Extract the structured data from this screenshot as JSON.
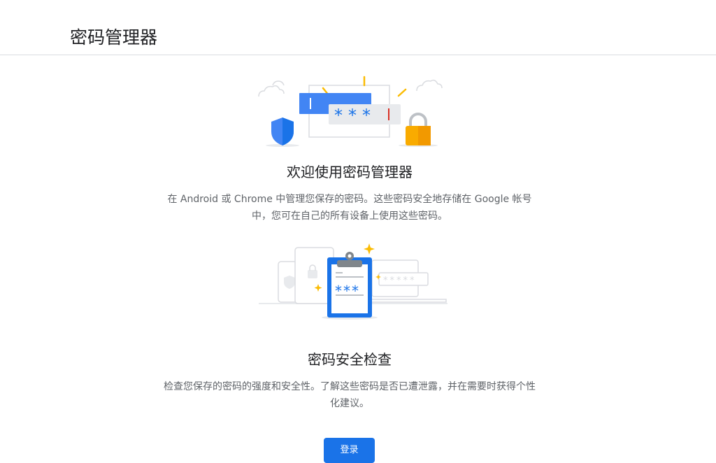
{
  "header": {
    "title": "密码管理器"
  },
  "welcome": {
    "title": "欢迎使用密码管理器",
    "description": "在 Android 或 Chrome 中管理您保存的密码。这些密码安全地存储在 Google 帐号中，您可在自己的所有设备上使用这些密码。",
    "masked_password": "***"
  },
  "checkup": {
    "title": "密码安全检查",
    "description": "检查您保存的密码的强度和安全性。了解这些密码是否已遭泄露，并在需要时获得个性化建议。",
    "masked_password": "***"
  },
  "actions": {
    "sign_in_label": "登录"
  },
  "colors": {
    "primary_blue": "#1a73e8",
    "shield_blue": "#4285f4",
    "lock_yellow": "#f9ab00",
    "divider": "#dadce0",
    "secondary_text": "#5f6368"
  }
}
